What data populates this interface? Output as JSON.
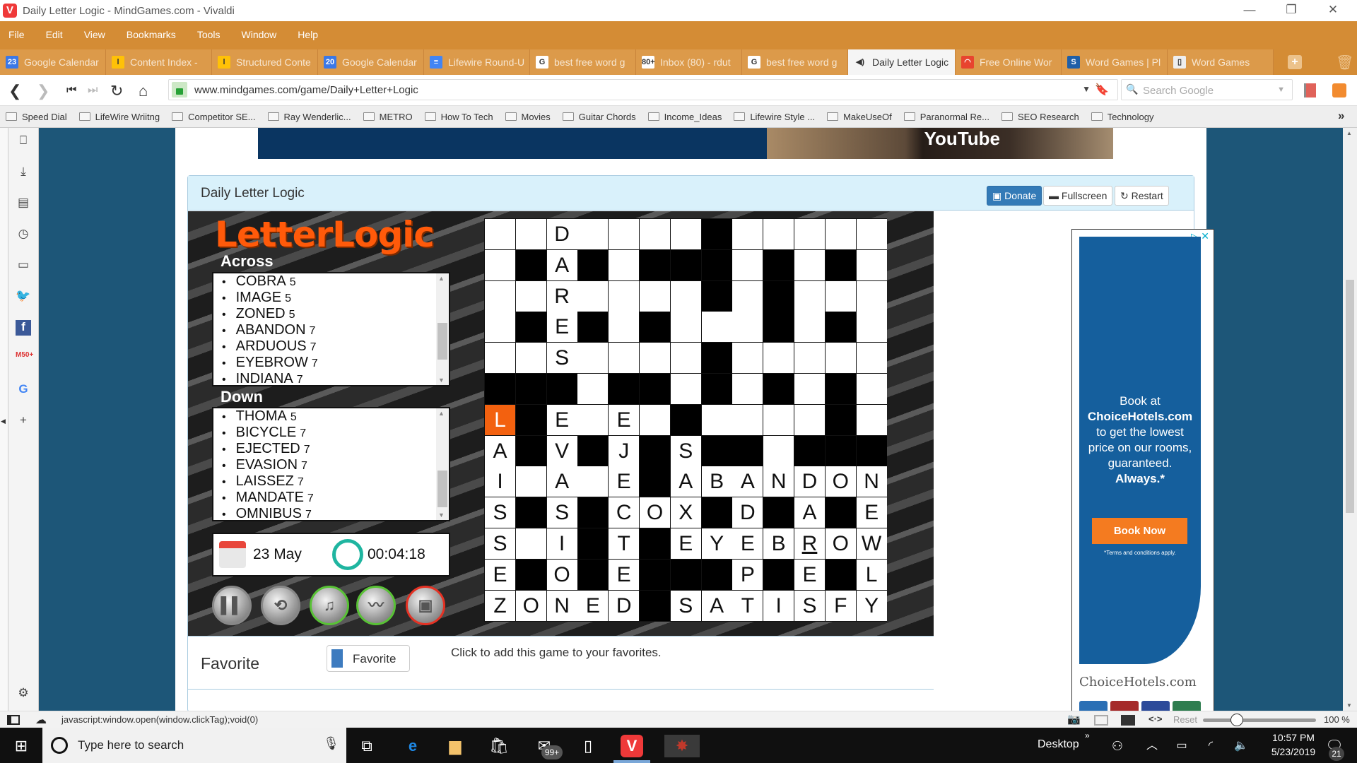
{
  "window": {
    "title": "Daily Letter Logic - MindGames.com - Vivaldi",
    "app_logo": "V"
  },
  "menu": [
    "File",
    "Edit",
    "View",
    "Bookmarks",
    "Tools",
    "Window",
    "Help"
  ],
  "tabs": [
    {
      "label": "Google Calendar",
      "icon": "calendar-icon",
      "badge": "23",
      "color": "#3b78e7"
    },
    {
      "label": "Content Index -",
      "icon": "lifewire-icon",
      "badge": "l",
      "color": "#ffc107"
    },
    {
      "label": "Structured Conte",
      "icon": "lifewire-icon",
      "badge": "l",
      "color": "#ffc107"
    },
    {
      "label": "Google Calendar",
      "icon": "calendar-icon",
      "badge": "20",
      "color": "#3b78e7"
    },
    {
      "label": "Lifewire Round-U",
      "icon": "docs-icon",
      "badge": "≡",
      "color": "#4285f4"
    },
    {
      "label": "best free word g",
      "icon": "google-icon",
      "badge": "G",
      "color": "#fff"
    },
    {
      "label": "Inbox (80) - rdut",
      "icon": "gmail-icon",
      "badge": "80+",
      "color": "#fff"
    },
    {
      "label": "best free word g",
      "icon": "google-icon",
      "badge": "G",
      "color": "#fff"
    },
    {
      "label": "Daily Letter Logic",
      "icon": "speaker-icon",
      "badge": "◀)",
      "color": "#f5f5f5",
      "active": true
    },
    {
      "label": "Free Online Wor",
      "icon": "site-icon",
      "badge": "◠",
      "color": "#e8442f"
    },
    {
      "label": "Word Games | Pl",
      "icon": "s-icon",
      "badge": "S",
      "color": "#1f5fa8"
    },
    {
      "label": "Word Games",
      "icon": "page-icon",
      "badge": "▯",
      "color": "#eee"
    }
  ],
  "address": {
    "url": "www.mindgames.com/game/Daily+Letter+Logic",
    "search_placeholder": "Search Google"
  },
  "bookmarks": [
    "Speed Dial",
    "LifeWire Wriitng",
    "Competitor SE...",
    "Ray Wenderlic...",
    "METRO",
    "How To Tech",
    "Movies",
    "Guitar Chords",
    "Income_Ideas",
    "Lifewire Style ...",
    "MakeUseOf",
    "Paranormal Re...",
    "SEO Research",
    "Technology"
  ],
  "banner": {
    "text": "YouTube"
  },
  "game": {
    "title": "Daily Letter Logic",
    "buttons": {
      "donate": "Donate",
      "fullscreen": "Fullscreen",
      "restart": "Restart"
    },
    "logo": "LetterLogic",
    "across_label": "Across",
    "down_label": "Down",
    "across": [
      {
        "word": "COBRA",
        "len": "5"
      },
      {
        "word": "IMAGE",
        "len": "5"
      },
      {
        "word": "ZONED",
        "len": "5"
      },
      {
        "word": "ABANDON",
        "len": "7"
      },
      {
        "word": "ARDUOUS",
        "len": "7"
      },
      {
        "word": "EYEBROW",
        "len": "7"
      },
      {
        "word": "INDIANA",
        "len": "7"
      }
    ],
    "down": [
      {
        "word": "THOMA",
        "len": "5"
      },
      {
        "word": "BICYCLE",
        "len": "7"
      },
      {
        "word": "EJECTED",
        "len": "7"
      },
      {
        "word": "EVASION",
        "len": "7"
      },
      {
        "word": "LAISSEZ",
        "len": "7"
      },
      {
        "word": "MANDATE",
        "len": "7"
      },
      {
        "word": "OMNIBUS",
        "len": "7"
      }
    ],
    "date": "23 May",
    "timer": "00:04:18",
    "controls": [
      "pause",
      "shuffle",
      "music",
      "sound",
      "fullscreen"
    ],
    "grid": [
      "..D....#.....",
      ".#A#.###.#.#.",
      "..R....#.#...",
      ".#E#.#...#.#.",
      "..S....#.....",
      "###.##.#.#.#.",
      "L#E.E.#....#.",
      "A#V#J#S##.###",
      "I.A.E#ABANDON",
      "S#S#COX#D#A#E",
      "S.I#T#EYEBROW",
      "E#O#E###P#E#L",
      "ZONED#SATISFY"
    ],
    "selected_cell": {
      "row": 6,
      "col": 0
    },
    "underlined_cell": {
      "row": 10,
      "col": 10
    }
  },
  "favorite": {
    "label": "Favorite",
    "button": "Favorite",
    "hint": "Click to add this game to your favorites."
  },
  "ad": {
    "lines": [
      "Book at",
      "ChoiceHotels.com",
      "to get the lowest",
      "price on our rooms,",
      "guaranteed.",
      "Always.*"
    ],
    "button": "Book Now",
    "terms": "*Terms and conditions apply.",
    "brand": "ChoiceHotels.com"
  },
  "statusbar": {
    "link": "javascript:window.open(window.clickTag);void(0)",
    "reset": "Reset",
    "zoom": "100 %",
    "zoom_level": 0.3
  },
  "taskbar": {
    "search_placeholder": "Type here to search",
    "desktop": "Desktop",
    "time": "10:57 PM",
    "date": "5/23/2019",
    "notifications": "21",
    "mail_badge": "99+"
  }
}
